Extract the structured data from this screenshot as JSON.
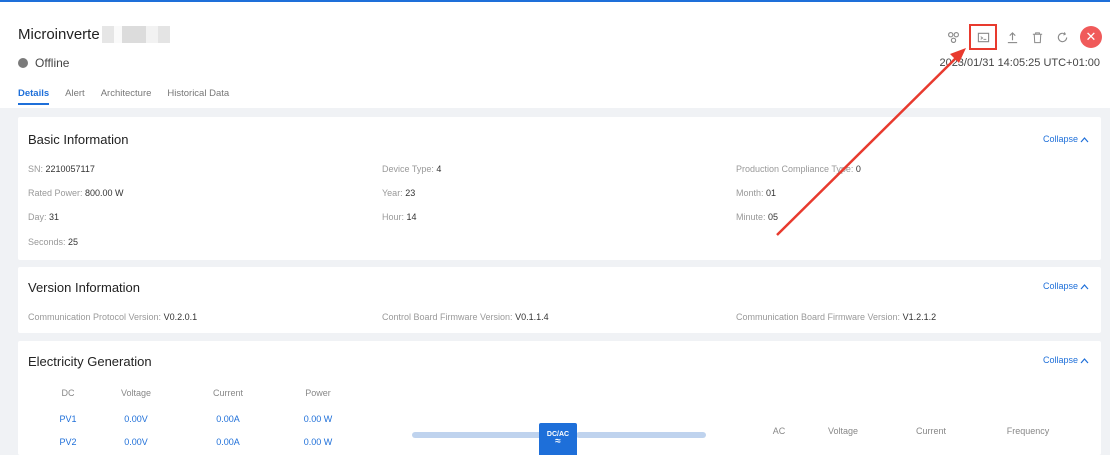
{
  "header": {
    "title": "Microinverte",
    "status": "Offline",
    "timestamp": "2023/01/31 14:05:25 UTC+01:00",
    "toolbar": [
      {
        "name": "topology-icon"
      },
      {
        "name": "console-icon"
      },
      {
        "name": "upload-icon"
      },
      {
        "name": "delete-icon"
      },
      {
        "name": "refresh-icon"
      },
      {
        "name": "close-icon",
        "glyph": "✕"
      }
    ],
    "tabs": [
      "Details",
      "Alert",
      "Architecture",
      "Historical Data"
    ]
  },
  "basic": {
    "title": "Basic Information",
    "collapse": "Collapse",
    "fields": [
      {
        "label": "SN: ",
        "value": "2210057117"
      },
      {
        "label": "Device Type: ",
        "value": "4"
      },
      {
        "label": "Production Compliance Type: ",
        "value": "0"
      },
      {
        "label": "Rated Power: ",
        "value": "800.00 W"
      },
      {
        "label": "Year: ",
        "value": "23"
      },
      {
        "label": "Month: ",
        "value": "01"
      },
      {
        "label": "Day: ",
        "value": "31"
      },
      {
        "label": "Hour: ",
        "value": "14"
      },
      {
        "label": "Minute: ",
        "value": "05"
      },
      {
        "label": "Seconds: ",
        "value": "25"
      }
    ]
  },
  "version": {
    "title": "Version Information",
    "collapse": "Collapse",
    "fields": [
      {
        "label": "Communication Protocol Version: ",
        "value": "V0.2.0.1"
      },
      {
        "label": "Control Board Firmware Version: ",
        "value": "V0.1.1.4"
      },
      {
        "label": "Communication Board Firmware Version: ",
        "value": "V1.2.1.2"
      }
    ]
  },
  "generation": {
    "title": "Electricity Generation",
    "collapse": "Collapse",
    "dc_headers": [
      "DC",
      "Voltage",
      "Current",
      "Power"
    ],
    "dc_rows": [
      [
        "PV1",
        "0.00V",
        "0.00A",
        "0.00 W"
      ],
      [
        "PV2",
        "0.00V",
        "0.00A",
        "0.00 W"
      ]
    ],
    "converter": "DC/AC",
    "converter_wave": "≈",
    "ac_headers": [
      "AC",
      "Voltage",
      "Current",
      "Frequency"
    ]
  },
  "colors": {
    "accent": "#1e6fd9",
    "close": "#f05a5a",
    "annotation": "#e83a2e"
  }
}
